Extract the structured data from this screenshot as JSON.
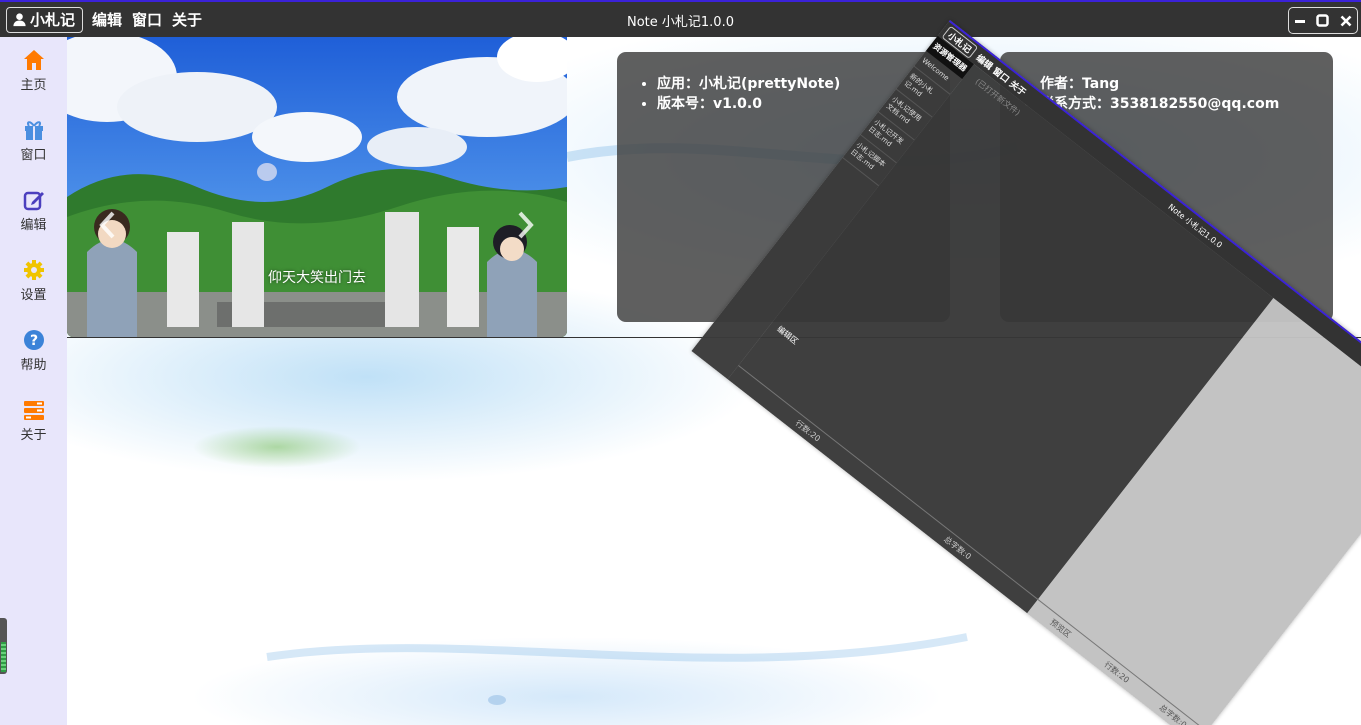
{
  "titlebar": {
    "brand_label": "小札记",
    "menu": [
      {
        "label": "编辑"
      },
      {
        "label": "窗口"
      },
      {
        "label": "关于"
      }
    ],
    "window_title": "Note 小札记1.0.0"
  },
  "sidebar": {
    "items": [
      {
        "label": "主页",
        "icon": "home-icon",
        "color": "#ff7a00"
      },
      {
        "label": "窗口",
        "icon": "gift-icon",
        "color": "#4a8fe0"
      },
      {
        "label": "编辑",
        "icon": "edit-icon",
        "color": "#4b3fbe"
      },
      {
        "label": "设置",
        "icon": "gear-icon",
        "color": "#f0c400"
      },
      {
        "label": "帮助",
        "icon": "help-icon",
        "color": "#3b83d8"
      },
      {
        "label": "关于",
        "icon": "list-icon",
        "color": "#ff7a00"
      }
    ]
  },
  "carousel": {
    "caption": "仰天大笑出门去"
  },
  "info_left": {
    "items": [
      {
        "label": "应用：小札记(prettyNote)"
      },
      {
        "label": "版本号：v1.0.0"
      }
    ]
  },
  "info_right": {
    "items": [
      {
        "label": "作者：Tang"
      },
      {
        "label": "联系方式：3538182550@qq.com"
      }
    ]
  },
  "mini_window": {
    "brand_label": "小札记",
    "menu_label": "编辑 窗口 关于",
    "title": "Note 小札记1.0.0",
    "side_header": "资源管理器",
    "files": [
      "Welcome",
      "新的小札记.md",
      "小札记使用文档.md",
      "小札记开发日志.md",
      "小札记脚本日志.md"
    ],
    "editor_hint": "(已打开新文件)",
    "editor_label": "编辑区",
    "preview_label": "预览区",
    "status_lines": "行数:20",
    "status_chars": "总字数:0"
  }
}
